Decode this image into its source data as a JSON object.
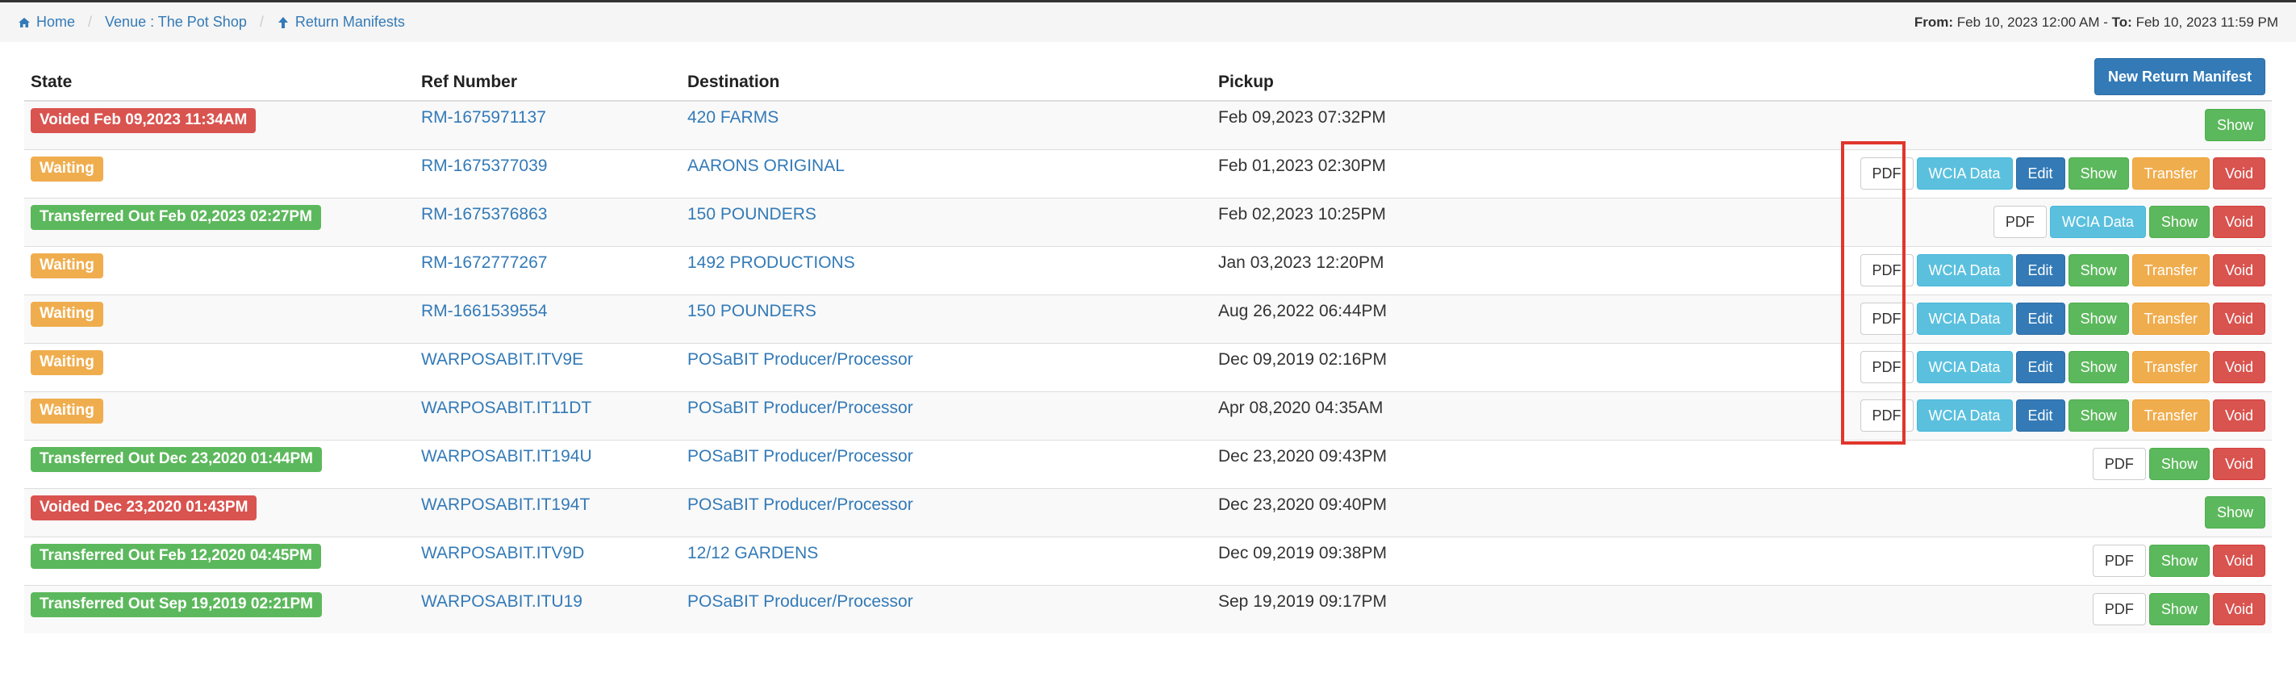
{
  "breadcrumb": {
    "home": "Home",
    "venue": "Venue : The Pot Shop",
    "current": "Return Manifests"
  },
  "date_range": {
    "from_label": "From:",
    "from_value": "Feb 10, 2023 12:00 AM",
    "dash": "-",
    "to_label": "To:",
    "to_value": "Feb 10, 2023 11:59 PM"
  },
  "table": {
    "headers": [
      "State",
      "Ref Number",
      "Destination",
      "Pickup"
    ],
    "new_button": "New Return Manifest",
    "button_labels": {
      "pdf": "PDF",
      "wcia": "WCIA Data",
      "edit": "Edit",
      "show": "Show",
      "transfer": "Transfer",
      "void": "Void"
    },
    "rows": [
      {
        "state": "Voided Feb 09,2023 11:34AM",
        "state_type": "danger",
        "ref": "RM-1675971137",
        "destination": "420 FARMS",
        "pickup": "Feb 09,2023 07:32PM",
        "actions": [
          "show"
        ]
      },
      {
        "state": "Waiting",
        "state_type": "warning",
        "ref": "RM-1675377039",
        "destination": "AARONS ORIGINAL",
        "pickup": "Feb 01,2023 02:30PM",
        "actions": [
          "pdf",
          "wcia",
          "edit",
          "show",
          "transfer",
          "void"
        ]
      },
      {
        "state": "Transferred Out Feb 02,2023 02:27PM",
        "state_type": "success",
        "ref": "RM-1675376863",
        "destination": "150 POUNDERS",
        "pickup": "Feb 02,2023 10:25PM",
        "actions": [
          "pdf",
          "wcia",
          "show",
          "void"
        ]
      },
      {
        "state": "Waiting",
        "state_type": "warning",
        "ref": "RM-1672777267",
        "destination": "1492 PRODUCTIONS",
        "pickup": "Jan 03,2023 12:20PM",
        "actions": [
          "pdf",
          "wcia",
          "edit",
          "show",
          "transfer",
          "void"
        ]
      },
      {
        "state": "Waiting",
        "state_type": "warning",
        "ref": "RM-1661539554",
        "destination": "150 POUNDERS",
        "pickup": "Aug 26,2022 06:44PM",
        "actions": [
          "pdf",
          "wcia",
          "edit",
          "show",
          "transfer",
          "void"
        ]
      },
      {
        "state": "Waiting",
        "state_type": "warning",
        "ref": "WARPOSABIT.ITV9E",
        "destination": "POSaBIT Producer/Processor",
        "pickup": "Dec 09,2019 02:16PM",
        "actions": [
          "pdf",
          "wcia",
          "edit",
          "show",
          "transfer",
          "void"
        ]
      },
      {
        "state": "Waiting",
        "state_type": "warning",
        "ref": "WARPOSABIT.IT11DT",
        "destination": "POSaBIT Producer/Processor",
        "pickup": "Apr 08,2020 04:35AM",
        "actions": [
          "pdf",
          "wcia",
          "edit",
          "show",
          "transfer",
          "void"
        ]
      },
      {
        "state": "Transferred Out Dec 23,2020 01:44PM",
        "state_type": "success",
        "ref": "WARPOSABIT.IT194U",
        "destination": "POSaBIT Producer/Processor",
        "pickup": "Dec 23,2020 09:43PM",
        "actions": [
          "pdf",
          "show",
          "void"
        ]
      },
      {
        "state": "Voided Dec 23,2020 01:43PM",
        "state_type": "danger",
        "ref": "WARPOSABIT.IT194T",
        "destination": "POSaBIT Producer/Processor",
        "pickup": "Dec 23,2020 09:40PM",
        "actions": [
          "show"
        ]
      },
      {
        "state": "Transferred Out Feb 12,2020 04:45PM",
        "state_type": "success",
        "ref": "WARPOSABIT.ITV9D",
        "destination": "12/12 GARDENS",
        "pickup": "Dec 09,2019 09:38PM",
        "actions": [
          "pdf",
          "show",
          "void"
        ]
      },
      {
        "state": "Transferred Out Sep 19,2019 02:21PM",
        "state_type": "success",
        "ref": "WARPOSABIT.ITU19",
        "destination": "POSaBIT Producer/Processor",
        "pickup": "Sep 19,2019 09:17PM",
        "actions": [
          "pdf",
          "show",
          "void"
        ]
      }
    ]
  },
  "colors": {
    "link": "#337ab7",
    "danger": "#d9534f",
    "warning": "#f0ad4e",
    "success": "#5cb85c",
    "info": "#5bc0de",
    "primary": "#337ab7",
    "highlight_box": "#e0362c"
  },
  "icons": {
    "home": "home-icon",
    "up_arrow": "arrow-up-icon"
  }
}
